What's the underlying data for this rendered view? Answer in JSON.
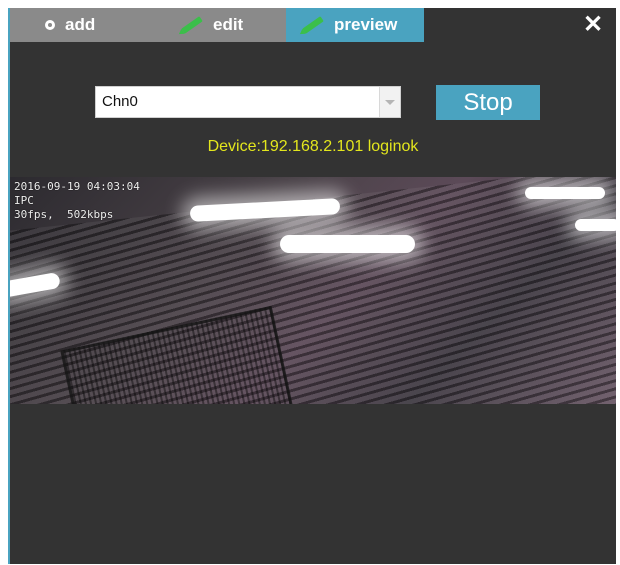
{
  "tabs": [
    {
      "label": "add",
      "icon": "plus-circle-icon",
      "active": false
    },
    {
      "label": "edit",
      "icon": "pencil-icon",
      "active": false
    },
    {
      "label": "preview",
      "icon": "pencil-icon",
      "active": true
    }
  ],
  "close_label": "✕",
  "channel_select": {
    "value": "Chn0"
  },
  "stop_button": {
    "label": "Stop"
  },
  "status": "Device:192.168.2.101 loginok",
  "video": {
    "osd_datetime": "2016-09-19 04:03:04",
    "osd_name": "IPC",
    "osd_stats": "30fps,  502kbps"
  },
  "colors": {
    "accent": "#4aa3c0",
    "tab_inactive": "#8a8a8a",
    "background": "#333333",
    "status_text": "#e3e61d",
    "pencil_icon": "#3bbf4a"
  }
}
